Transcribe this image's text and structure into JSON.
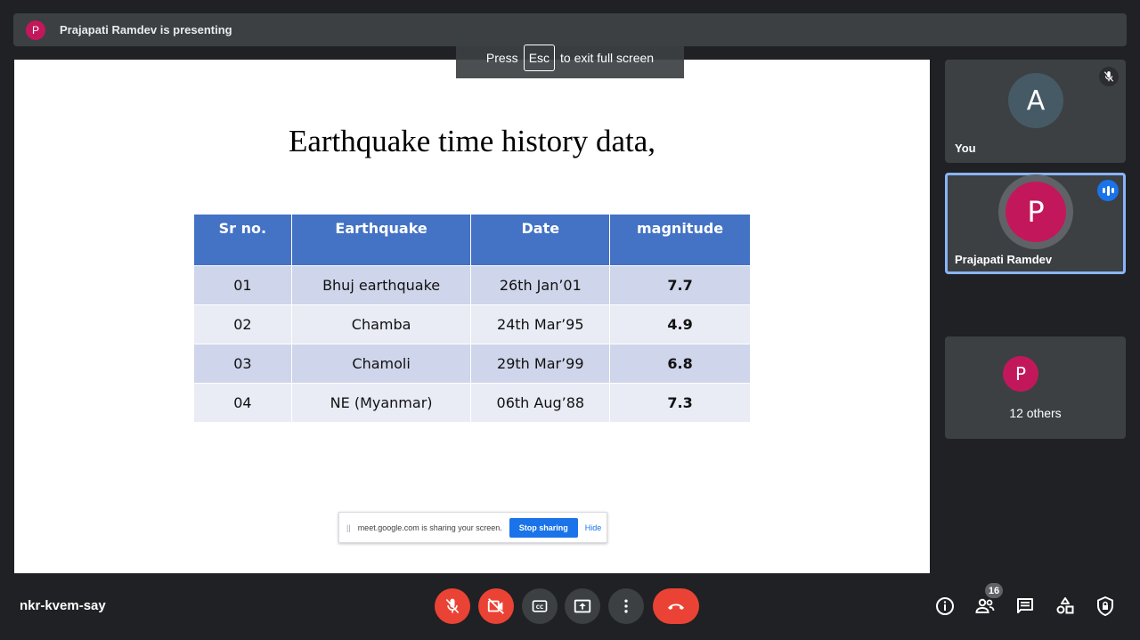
{
  "banner": {
    "avatar_letter": "P",
    "text": "Prajapati Ramdev is presenting"
  },
  "fullscreen_toast": {
    "press": "Press",
    "key": "Esc",
    "rest": "to exit full screen"
  },
  "slide": {
    "title": "Earthquake time history data,",
    "table": {
      "headers": [
        "Sr no.",
        "Earthquake",
        "Date",
        "magnitude"
      ],
      "rows": [
        [
          "01",
          "Bhuj earthquake",
          "26th Jan’01",
          "7.7"
        ],
        [
          "02",
          "Chamba",
          "24th Mar’95",
          "4.9"
        ],
        [
          "03",
          "Chamoli",
          "29th Mar’99",
          "6.8"
        ],
        [
          "04",
          "NE (Myanmar)",
          "06th Aug’88",
          "7.3"
        ]
      ]
    }
  },
  "share_bar": {
    "grip": "||",
    "message": "meet.google.com is sharing your screen.",
    "stop_label": "Stop sharing",
    "hide_label": "Hide"
  },
  "participants": {
    "self": {
      "letter": "A",
      "name": "You",
      "avatar_color": "#455a64"
    },
    "presenter": {
      "letter": "P",
      "name": "Prajapati Ramdev",
      "avatar_color": "#c2185b"
    },
    "others": {
      "letter": "P",
      "label": "12 others",
      "avatar_color": "#c2185b"
    }
  },
  "bottom_bar": {
    "meeting_code": "nkr-kvem-say",
    "people_count": "16",
    "controls": [
      "mic-off",
      "camera-off",
      "captions",
      "present",
      "more-options",
      "leave-call"
    ],
    "right_icons": [
      "info",
      "people",
      "chat",
      "activities",
      "host-controls"
    ]
  },
  "colors": {
    "accent": "#1a73e8",
    "danger": "#ea4335",
    "table_header": "#4472c4"
  }
}
